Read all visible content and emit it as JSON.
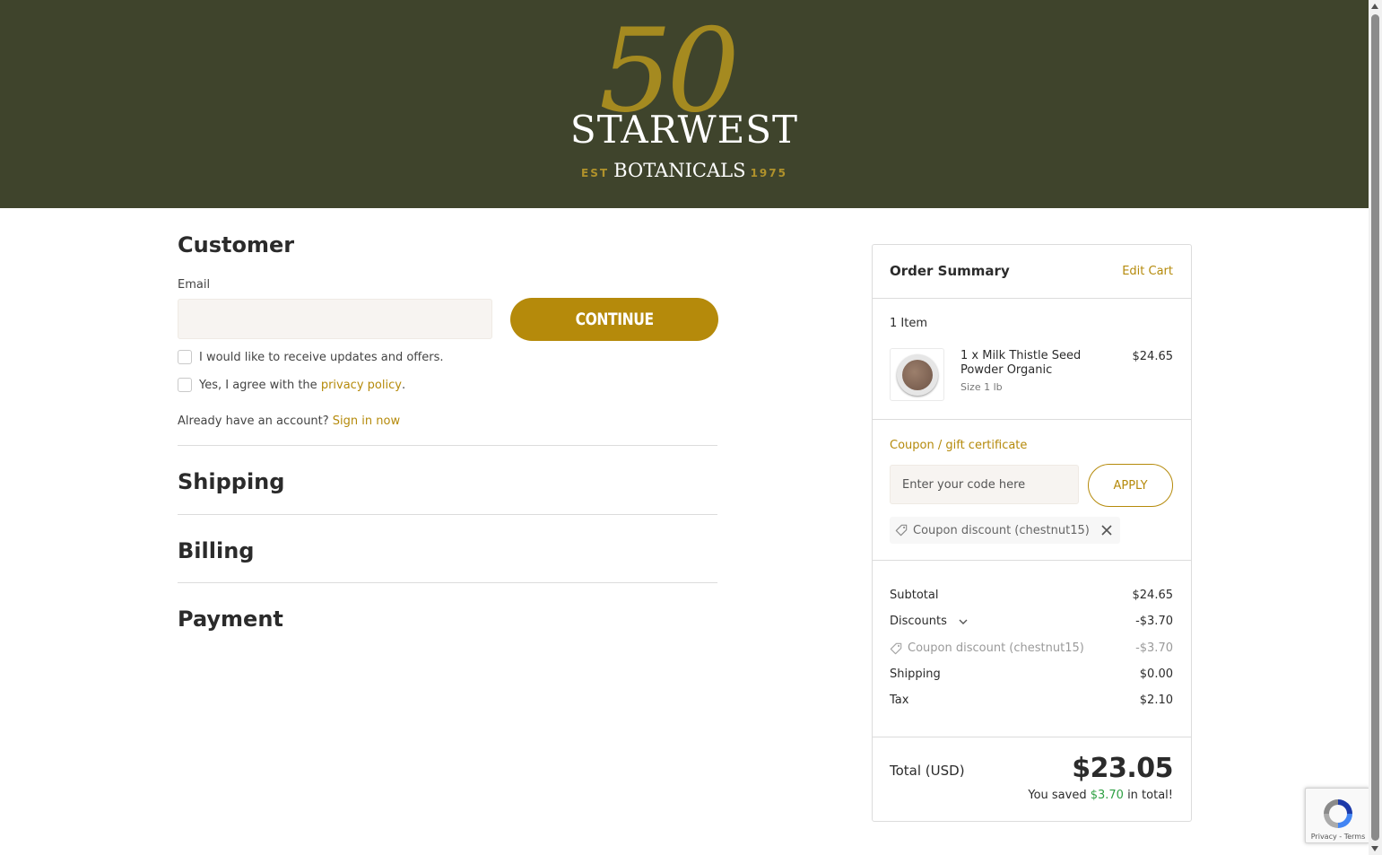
{
  "brand": {
    "anniversary": "50",
    "name": "STARWEST",
    "est_label": "EST",
    "sub_name": "BOTANICALS",
    "year": "1975"
  },
  "customer": {
    "heading": "Customer",
    "email_label": "Email",
    "email_value": "",
    "continue_label": "CONTINUE",
    "updates_label": "I would like to receive updates and offers.",
    "privacy_prefix": "Yes, I agree with the ",
    "privacy_link": "privacy policy",
    "privacy_suffix": ".",
    "account_prefix": "Already have an account? ",
    "sign_in_link": "Sign in now"
  },
  "sections": {
    "shipping": "Shipping",
    "billing": "Billing",
    "payment": "Payment"
  },
  "summary": {
    "title": "Order Summary",
    "edit_cart": "Edit Cart",
    "item_count": "1 Item",
    "product": {
      "name": "1 x Milk Thistle Seed Powder Organic",
      "size": "Size 1 lb",
      "price": "$24.65"
    },
    "coupon_label": "Coupon / gift certificate",
    "coupon_placeholder": "Enter your code here",
    "apply_label": "APPLY",
    "applied_coupon": "Coupon discount (chestnut15)",
    "subtotal_label": "Subtotal",
    "subtotal_value": "$24.65",
    "discounts_label": "Discounts",
    "discounts_value": "-$3.70",
    "coupon_line_label": "Coupon discount (chestnut15)",
    "coupon_line_value": "-$3.70",
    "shipping_label": "Shipping",
    "shipping_value": "$0.00",
    "tax_label": "Tax",
    "tax_value": "$2.10",
    "total_label": "Total (USD)",
    "total_value": "$23.05",
    "saved_prefix": "You saved ",
    "saved_amount": "$3.70",
    "saved_suffix": " in total!"
  },
  "recaptcha": {
    "footer": "Privacy - Terms"
  },
  "colors": {
    "header_bg": "#3f442c",
    "accent": "#b58a0b",
    "savings_green": "#2ea043"
  },
  "icons": [
    "tag-icon",
    "close-icon",
    "chevron-down-icon",
    "recaptcha-icon"
  ]
}
